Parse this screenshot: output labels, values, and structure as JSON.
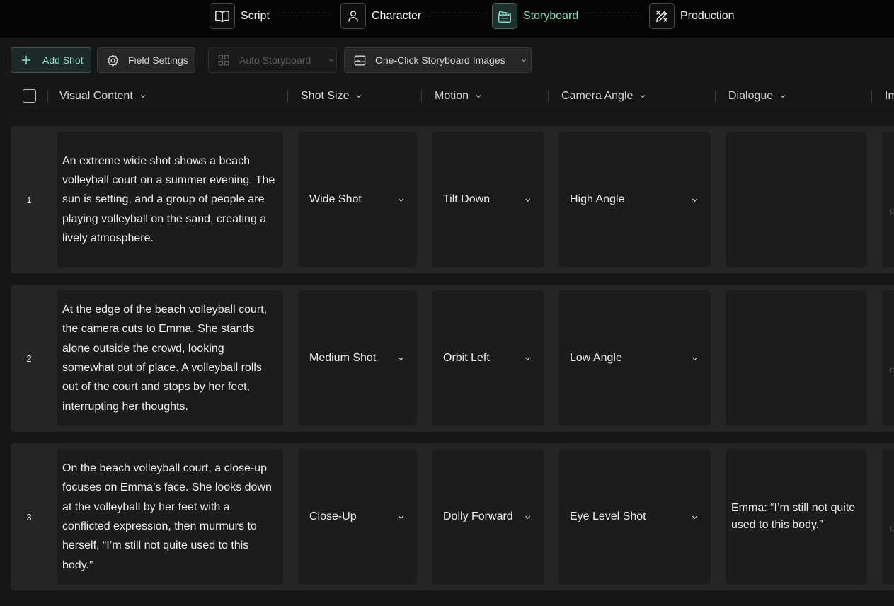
{
  "stepper": {
    "steps": [
      {
        "label": "Script",
        "icon": "book-icon"
      },
      {
        "label": "Character",
        "icon": "user-icon"
      },
      {
        "label": "Storyboard",
        "icon": "clapperboard-icon",
        "active": true
      },
      {
        "label": "Production",
        "icon": "tools-icon"
      }
    ]
  },
  "toolbar": {
    "add_shot": "Add Shot",
    "field_settings": "Field Settings",
    "auto_storyboard": "Auto Storyboard",
    "one_click_images": "One-Click Storyboard Images"
  },
  "columns": {
    "visual_content": "Visual Content",
    "shot_size": "Shot Size",
    "motion": "Motion",
    "camera_angle": "Camera Angle",
    "dialogue": "Dialogue",
    "image_partial": "Im"
  },
  "rows": [
    {
      "num": "1",
      "visual": "An extreme wide shot shows a beach volleyball court on a summer evening. The sun is setting, and a group of people are playing volleyball on the sand, creating a lively atmosphere.",
      "shot_size": "Wide Shot",
      "motion": "Tilt Down",
      "camera_angle": "High Angle",
      "dialogue": ""
    },
    {
      "num": "2",
      "visual": "At the edge of the beach volleyball court, the camera cuts to Emma. She stands alone outside the crowd, looking somewhat out of place. A volleyball rolls out of the court and stops by her feet, interrupting her thoughts.",
      "shot_size": "Medium Shot",
      "motion": "Orbit Left",
      "camera_angle": "Low Angle",
      "dialogue": ""
    },
    {
      "num": "3",
      "visual": "On the beach volleyball court, a close-up focuses on Emma’s face. She looks down at the volleyball by her feet with a conflicted expression, then murmurs to herself, “I’m still not quite used to this body.”",
      "shot_size": "Close-Up",
      "motion": "Dolly Forward",
      "camera_angle": "Eye Level Shot",
      "dialogue": "Emma: “I’m still not quite used to this body.”"
    }
  ],
  "colors": {
    "accent": "#7fdcc0",
    "background": "#161616",
    "row_bg": "#252525",
    "cell_bg": "#1c1c1c"
  }
}
